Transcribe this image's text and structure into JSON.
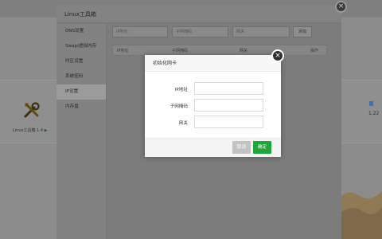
{
  "background": {
    "tool_label": "Linux工具箱 1.4",
    "tool_play_glyph": "▶",
    "right_number": "1.22"
  },
  "window": {
    "title": "Linux工具箱",
    "close_glyph": "×",
    "sidebar": {
      "items": [
        {
          "label": "DNS设置",
          "active": false
        },
        {
          "label": "Swap/虚拟内存",
          "active": false
        },
        {
          "label": "时区设置",
          "active": false
        },
        {
          "label": "系统密码",
          "active": false
        },
        {
          "label": "IP设置",
          "active": true
        },
        {
          "label": "内存盘",
          "active": false
        }
      ]
    },
    "form": {
      "ip_placeholder": "IP地址",
      "netmask_placeholder": "子网掩码",
      "gateway_placeholder": "网关",
      "add_label": "添加"
    },
    "table": {
      "columns": [
        "IP地址",
        "子网掩码",
        "网关",
        "操作"
      ]
    }
  },
  "modal": {
    "title": "初始化网卡",
    "close_glyph": "×",
    "fields": [
      {
        "label": "IP地址",
        "value": ""
      },
      {
        "label": "子网掩码",
        "value": ""
      },
      {
        "label": "网关",
        "value": ""
      }
    ],
    "cancel_label": "取消",
    "ok_label": "确定"
  },
  "colors": {
    "ok_button": "#20a53a",
    "cancel_button": "#c3c3c3",
    "overlay": "#7d7d7d"
  }
}
